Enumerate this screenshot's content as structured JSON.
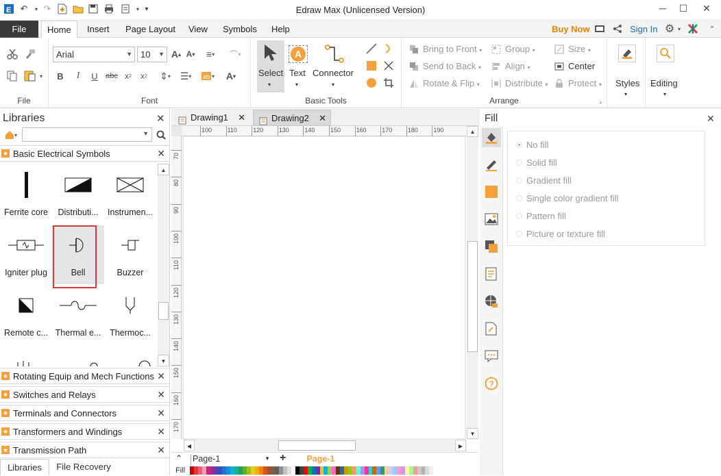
{
  "window": {
    "title": "Edraw Max (Unlicensed Version)"
  },
  "menu": {
    "file": "File",
    "tabs": [
      "Home",
      "Insert",
      "Page Layout",
      "View",
      "Symbols",
      "Help"
    ],
    "buy_now": "Buy Now",
    "sign_in": "Sign In"
  },
  "ribbon": {
    "file_group_label": "File",
    "font_group_label": "Font",
    "font_name": "Arial",
    "font_size": "10",
    "basic_tools_label": "Basic Tools",
    "select": "Select",
    "text": "Text",
    "connector": "Connector",
    "text_icon_letter": "A",
    "arrange_label": "Arrange",
    "bring_to_front": "Bring to Front",
    "send_to_back": "Send to Back",
    "rotate_flip": "Rotate & Flip",
    "group": "Group",
    "align": "Align",
    "distribute": "Distribute",
    "size": "Size",
    "center": "Center",
    "protect": "Protect",
    "styles": "Styles",
    "editing": "Editing"
  },
  "libraries": {
    "title": "Libraries",
    "search_placeholder": "",
    "open_library": "Basic Electrical Symbols",
    "symbols": [
      "Ferrite core",
      "Distributi...",
      "Instrumen...",
      "Igniter plug",
      "Bell",
      "Buzzer",
      "Remote c...",
      "Thermal e...",
      "Thermoc..."
    ],
    "selected_symbol": "Bell",
    "other_libraries": [
      "Rotating Equip and Mech Functions",
      "Switches and Relays",
      "Terminals and Connectors",
      "Transformers and Windings",
      "Transmission Path"
    ],
    "bottom_tabs": [
      "Libraries",
      "File Recovery"
    ]
  },
  "documents": {
    "tabs": [
      "Drawing1",
      "Drawing2"
    ],
    "active": "Drawing2"
  },
  "rulers": {
    "h_ticks": [
      "100",
      "110",
      "120",
      "130",
      "140",
      "150",
      "160",
      "170",
      "180",
      "190"
    ],
    "v_ticks": [
      "70",
      "80",
      "90",
      "100",
      "110",
      "120",
      "130",
      "140",
      "150",
      "160",
      "170"
    ]
  },
  "pages": {
    "selector": "Page-1",
    "active_tab": "Page-1",
    "fill_label": "Fill"
  },
  "fill_panel": {
    "title": "Fill",
    "options": [
      "No fill",
      "Solid fill",
      "Gradient fill",
      "Single color gradient fill",
      "Pattern fill",
      "Picture or texture fill"
    ],
    "selected": "No fill"
  },
  "colors": {
    "accent_orange": "#f4a13b",
    "buy_now": "#e8830c",
    "sign_in": "#1a6fb5",
    "selection_red": "#e03a3a"
  },
  "palette": [
    "#c00000",
    "#e8323c",
    "#f06070",
    "#f4a0b0",
    "#d02080",
    "#9030a0",
    "#6040b0",
    "#3050c0",
    "#2070d0",
    "#1890e0",
    "#10b0d0",
    "#10b0a0",
    "#20a060",
    "#60b030",
    "#a0c020",
    "#e0d020",
    "#f0b000",
    "#f08000",
    "#e05010",
    "#a05030",
    "#806040",
    "#606060",
    "#909090",
    "#c0c0c0",
    "#e0e0e0",
    "#ffffff",
    "#000000",
    "#404040",
    "#ff0000",
    "#00b050",
    "#0070c0",
    "#7030a0",
    "#ffc000",
    "#00b0f0",
    "#92d050",
    "#ff66cc",
    "#663300",
    "#336699",
    "#cc9900",
    "#99cc00",
    "#ff9966",
    "#66ffcc",
    "#9999ff",
    "#ff3399",
    "#33cccc",
    "#cc6600",
    "#6699ff",
    "#339966",
    "#ffcc99",
    "#ccccff",
    "#99ccff",
    "#ff99cc",
    "#cc99ff",
    "#ffff99",
    "#99ff99",
    "#ff9999",
    "#c9c9c9",
    "#b0b0b0",
    "#d8d8d8",
    "#efefef"
  ]
}
